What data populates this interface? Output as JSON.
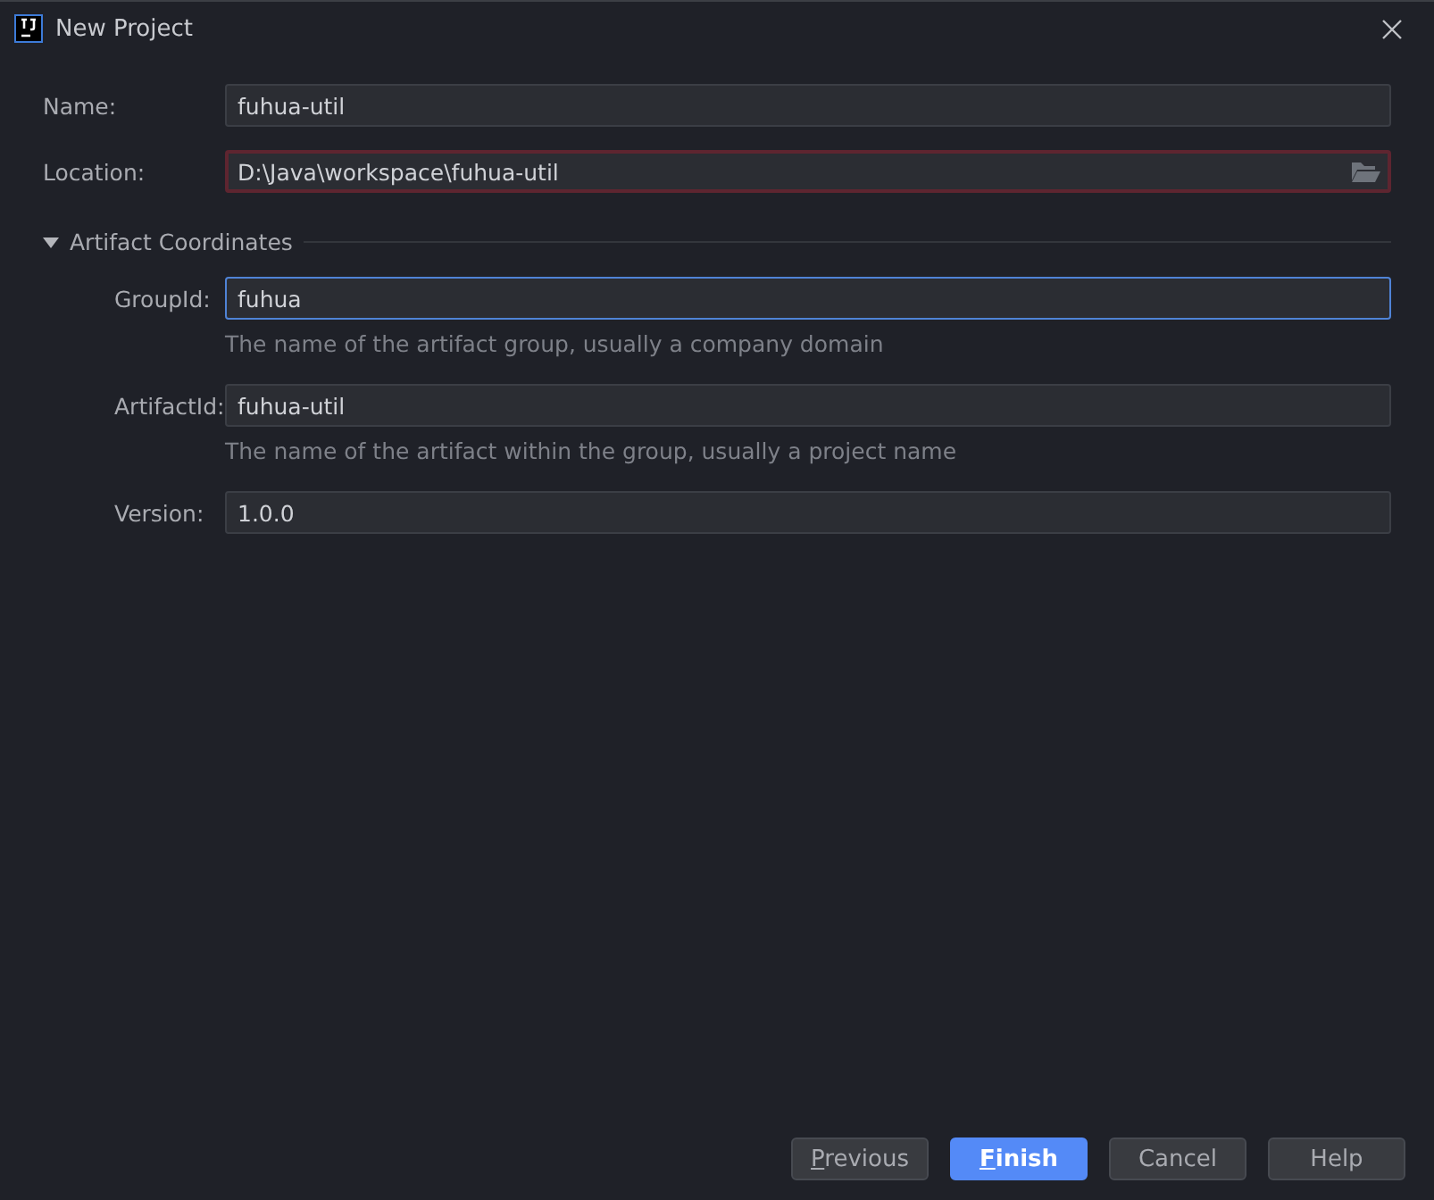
{
  "window": {
    "title": "New Project"
  },
  "fields": [
    {
      "label": "Name:",
      "value": "fuhua-util",
      "invalid": false,
      "focused": false
    },
    {
      "label": "Location:",
      "value": "D:\\Java\\workspace\\fuhua-util",
      "invalid": true,
      "focused": false,
      "browse": true
    }
  ],
  "section": {
    "title": "Artifact Coordinates",
    "expanded": true,
    "fields": [
      {
        "label": "GroupId:",
        "value": "fuhua",
        "invalid": false,
        "focused": true,
        "hint": "The name of the artifact group, usually a company domain"
      },
      {
        "label": "ArtifactId:",
        "value": "fuhua-util",
        "invalid": false,
        "focused": false,
        "hint": "The name of the artifact within the group, usually a project name"
      },
      {
        "label": "Version:",
        "value": "1.0.0",
        "invalid": false,
        "focused": false
      }
    ]
  },
  "buttons": [
    {
      "label": "Previous",
      "primary": false,
      "mnemonic": true
    },
    {
      "label": "Finish",
      "primary": true,
      "mnemonic": true
    },
    {
      "label": "Cancel",
      "primary": false,
      "mnemonic": false
    },
    {
      "label": "Help",
      "primary": false,
      "mnemonic": false
    }
  ]
}
